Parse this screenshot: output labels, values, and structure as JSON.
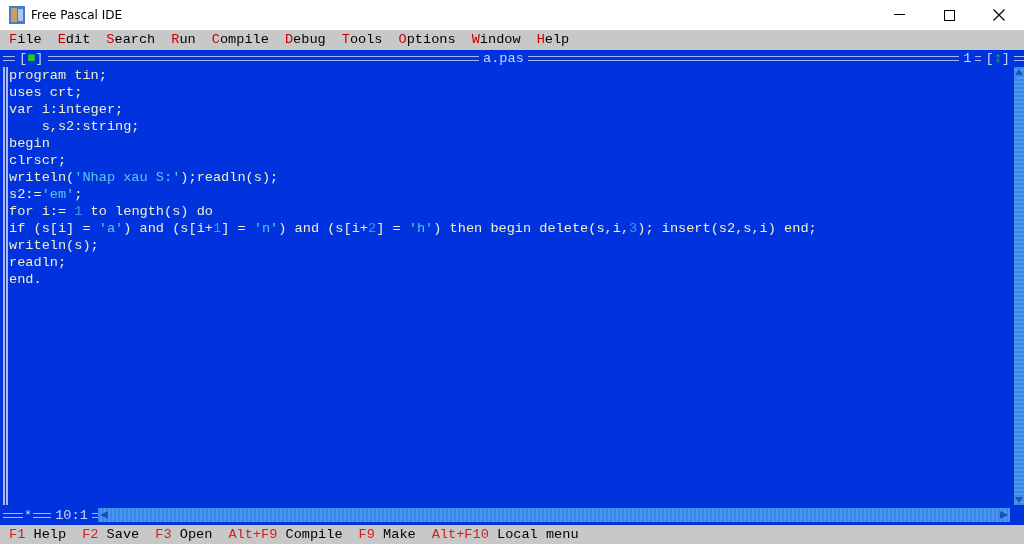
{
  "window": {
    "title": "Free Pascal IDE"
  },
  "menu": [
    {
      "hotkey": "F",
      "rest": "ile"
    },
    {
      "hotkey": "E",
      "rest": "dit"
    },
    {
      "hotkey": "S",
      "rest": "earch"
    },
    {
      "hotkey": "R",
      "rest": "un"
    },
    {
      "hotkey": "C",
      "rest": "ompile"
    },
    {
      "hotkey": "D",
      "rest": "ebug"
    },
    {
      "hotkey": "T",
      "rest": "ools"
    },
    {
      "hotkey": "O",
      "rest": "ptions"
    },
    {
      "hotkey": "W",
      "rest": "indow"
    },
    {
      "hotkey": "H",
      "rest": "elp"
    }
  ],
  "editor": {
    "close_box": "[■]",
    "title": "a.pas",
    "window_number": "1",
    "zoom_box": "[↕]",
    "modified_mark": "*",
    "cursor": "10:1",
    "lines": [
      [
        {
          "kind": "plain",
          "text": "program tin;"
        }
      ],
      [
        {
          "kind": "plain",
          "text": "uses crt;"
        }
      ],
      [
        {
          "kind": "plain",
          "text": "var i:integer;"
        }
      ],
      [
        {
          "kind": "plain",
          "text": "    s,s2:string;"
        }
      ],
      [
        {
          "kind": "plain",
          "text": "begin"
        }
      ],
      [
        {
          "kind": "plain",
          "text": "clrscr;"
        }
      ],
      [
        {
          "kind": "plain",
          "text": "writeln("
        },
        {
          "kind": "string",
          "text": "'Nhap xau S:'"
        },
        {
          "kind": "plain",
          "text": ");readln(s);"
        }
      ],
      [
        {
          "kind": "plain",
          "text": "s2:="
        },
        {
          "kind": "string",
          "text": "'em'"
        },
        {
          "kind": "plain",
          "text": ";"
        }
      ],
      [
        {
          "kind": "plain",
          "text": "for i:= "
        },
        {
          "kind": "number",
          "text": "1"
        },
        {
          "kind": "plain",
          "text": " to length(s) do"
        }
      ],
      [
        {
          "kind": "plain",
          "text": "if (s[i] = "
        },
        {
          "kind": "string",
          "text": "'a'"
        },
        {
          "kind": "plain",
          "text": ") and (s[i+"
        },
        {
          "kind": "number",
          "text": "1"
        },
        {
          "kind": "plain",
          "text": "] = "
        },
        {
          "kind": "string",
          "text": "'n'"
        },
        {
          "kind": "plain",
          "text": ") and (s[i+"
        },
        {
          "kind": "number",
          "text": "2"
        },
        {
          "kind": "plain",
          "text": "] = "
        },
        {
          "kind": "string",
          "text": "'h'"
        },
        {
          "kind": "plain",
          "text": ") then begin delete(s,i,"
        },
        {
          "kind": "number",
          "text": "3"
        },
        {
          "kind": "plain",
          "text": "); insert(s2,s,i) end;"
        }
      ],
      [
        {
          "kind": "plain",
          "text": "writeln(s);"
        }
      ],
      [
        {
          "kind": "plain",
          "text": "readln;"
        }
      ],
      [
        {
          "kind": "plain",
          "text": "end."
        }
      ]
    ]
  },
  "status_bar": [
    {
      "key": "F1",
      "label": "Help"
    },
    {
      "key": "F2",
      "label": "Save"
    },
    {
      "key": "F3",
      "label": "Open"
    },
    {
      "key": "Alt+F9",
      "label": "Compile"
    },
    {
      "key": "F9",
      "label": "Make"
    },
    {
      "key": "Alt+F10",
      "label": "Local menu"
    }
  ]
}
